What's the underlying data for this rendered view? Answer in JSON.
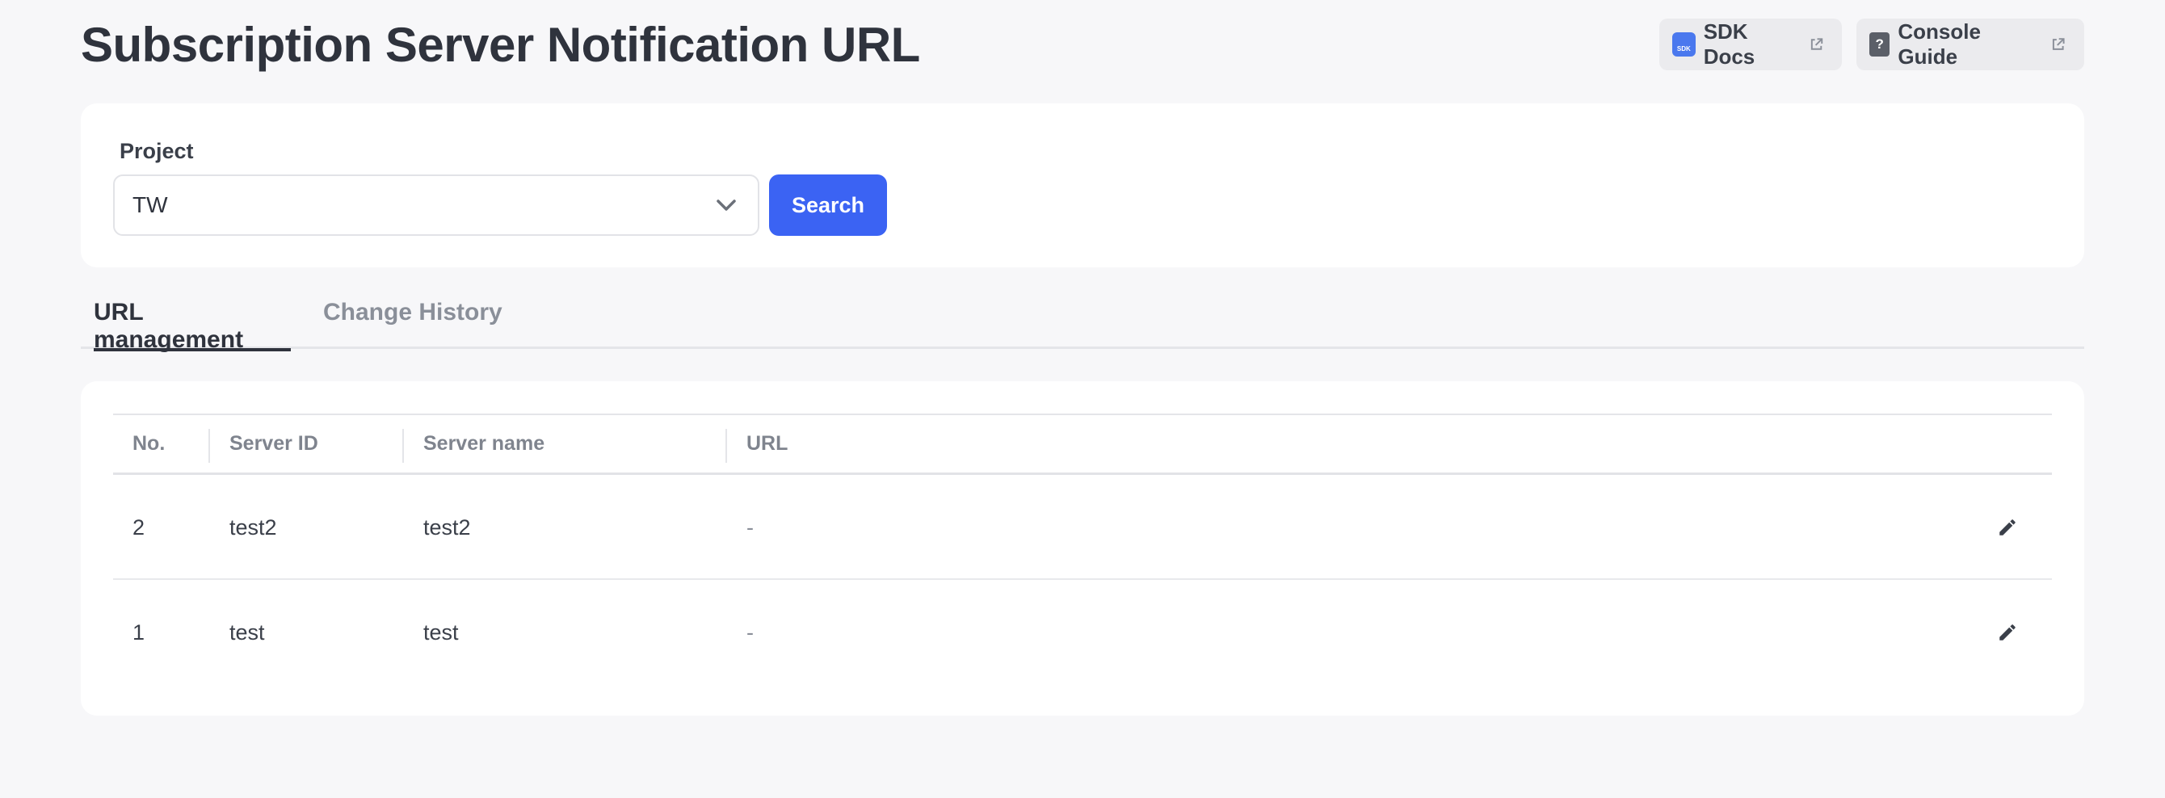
{
  "header": {
    "title": "Subscription Server Notification URL",
    "links": [
      {
        "label": "SDK Docs",
        "icon": "sdk-icon",
        "icon_text": "SDK"
      },
      {
        "label": "Console Guide",
        "icon": "help-document-icon",
        "icon_text": "?"
      }
    ]
  },
  "search": {
    "label": "Project",
    "selected": "TW",
    "button": "Search"
  },
  "tabs": [
    {
      "label": "URL management",
      "active": true
    },
    {
      "label": "Change History",
      "active": false
    }
  ],
  "table": {
    "columns": [
      "No.",
      "Server ID",
      "Server name",
      "URL"
    ],
    "rows": [
      {
        "no": "2",
        "server_id": "test2",
        "server_name": "test2",
        "url": "-"
      },
      {
        "no": "1",
        "server_id": "test",
        "server_name": "test",
        "url": "-"
      }
    ]
  },
  "colors": {
    "accent": "#3b63f3",
    "background": "#f7f7f9",
    "text": "#2f333d"
  }
}
